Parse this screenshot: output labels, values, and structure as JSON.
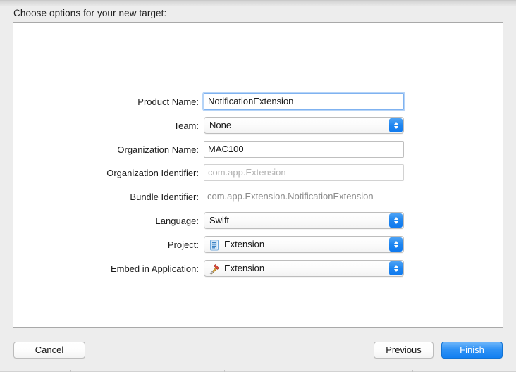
{
  "sheet": {
    "title": "Choose options for your new target:"
  },
  "form": {
    "rows": [
      {
        "label": "Product Name:",
        "control": "textfield",
        "value": "NotificationExtension",
        "placeholder": "",
        "focused": true
      },
      {
        "label": "Team:",
        "control": "popup",
        "value": "None",
        "icon": ""
      },
      {
        "label": "Organization Name:",
        "control": "textfield",
        "value": "MAC100",
        "placeholder": "",
        "focused": false
      },
      {
        "label": "Organization Identifier:",
        "control": "textfield",
        "value": "",
        "placeholder": "com.app.Extension",
        "focused": false
      },
      {
        "label": "Bundle Identifier:",
        "control": "static",
        "value": "com.app.Extension.NotificationExtension"
      },
      {
        "label": "Language:",
        "control": "popup",
        "value": "Swift",
        "icon": ""
      },
      {
        "label": "Project:",
        "control": "popup",
        "value": "Extension",
        "icon": "xcode-project-document-icon"
      },
      {
        "label": "Embed in Application:",
        "control": "popup",
        "value": "Extension",
        "icon": "xcode-target-hammer-icon"
      }
    ]
  },
  "footer": {
    "cancel_label": "Cancel",
    "previous_label": "Previous",
    "finish_label": "Finish"
  },
  "colors": {
    "accent_blue": "#1380f1",
    "popup_arrow_blue": "#1f86f0",
    "focus_ring": "#7fb2f0",
    "window_background": "#ededed",
    "panel_background": "#ffffff",
    "placeholder_text": "#b3b3b3",
    "static_text": "#8b8b8b"
  }
}
